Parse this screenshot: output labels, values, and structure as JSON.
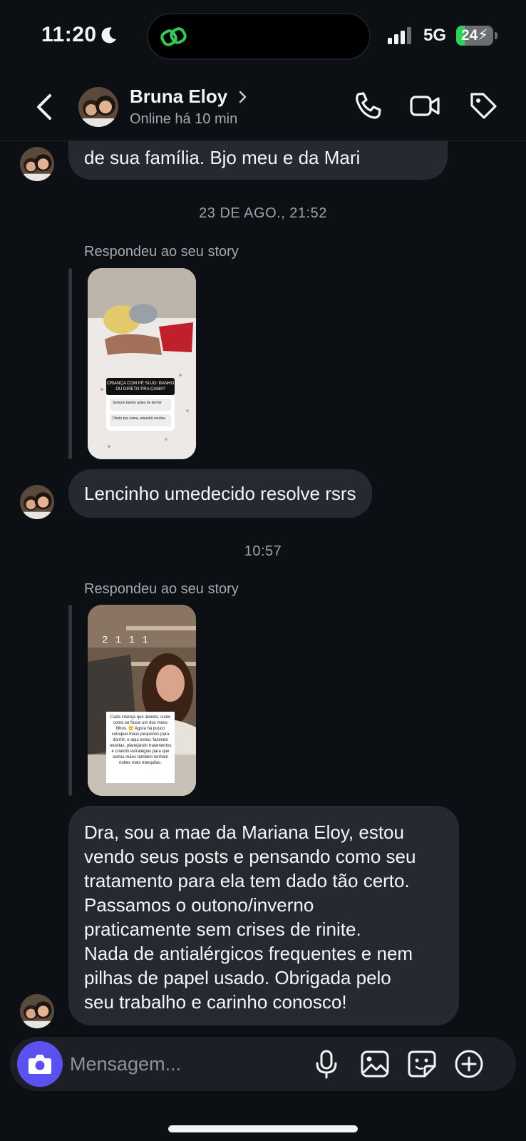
{
  "status_bar": {
    "time": "11:20",
    "network": "5G",
    "battery": "24",
    "battery_level": 0.24,
    "icons": [
      "moon-icon",
      "threads-link-icon",
      "signal-icon",
      "battery-charging-icon"
    ]
  },
  "header": {
    "name": "Bruna Eloy",
    "status": "Online há 10 min",
    "icons": [
      "back-chevron-icon",
      "chevron-right-icon",
      "phone-icon",
      "video-camera-icon",
      "tag-icon"
    ]
  },
  "messages": {
    "first_bubble": "de sua família.  Bjo meu e da Mari",
    "divider_1": "23 DE AGO., 21:52",
    "reply_label_1": "Respondeu ao seu story",
    "story_1": {
      "question": "CRIANÇA COM PÉ SUJO: BANHO OU DIRETO PRA CAMA?",
      "option_1": "Sempre banho antes de dormir",
      "option_2": "Direto pra cama, amanhã resolve"
    },
    "bubble_2": "Lencinho umedecido resolve rsrs",
    "divider_2": "10:57",
    "reply_label_2": "Respondeu ao seu story",
    "story_2": {
      "counter": "2 1 1 1",
      "caption": "Cada criança que atendo, cuido como se fosse um dos meus filhos. 😌 Agora há pouco coloquei meus pequenos para dormir, e aqui estou: fazendo receitas, planejando tratamentos e criando estratégias para que outras mães também tenham noites mais tranquilas."
    },
    "bubble_3_lines": [
      "Dra, sou a mae da Mariana Eloy,  estou",
      "vendo seus posts e pensando como seu",
      "tratamento para ela tem dado tão certo.",
      "Passamos o outono/inverno",
      "praticamente sem crises de rinite.",
      "Nada de antialérgicos frequentes e nem",
      "pilhas de papel usado. Obrigada pelo",
      "seu trabalho e carinho conosco!"
    ]
  },
  "composer": {
    "placeholder": "Mensagem...",
    "icons": [
      "camera-icon",
      "microphone-icon",
      "gallery-icon",
      "sticker-icon",
      "plus-circle-icon"
    ]
  },
  "colors": {
    "background": "#0c1015",
    "bubble": "#262a30",
    "accent": "#5b51f0",
    "battery_green": "#2fd158"
  }
}
